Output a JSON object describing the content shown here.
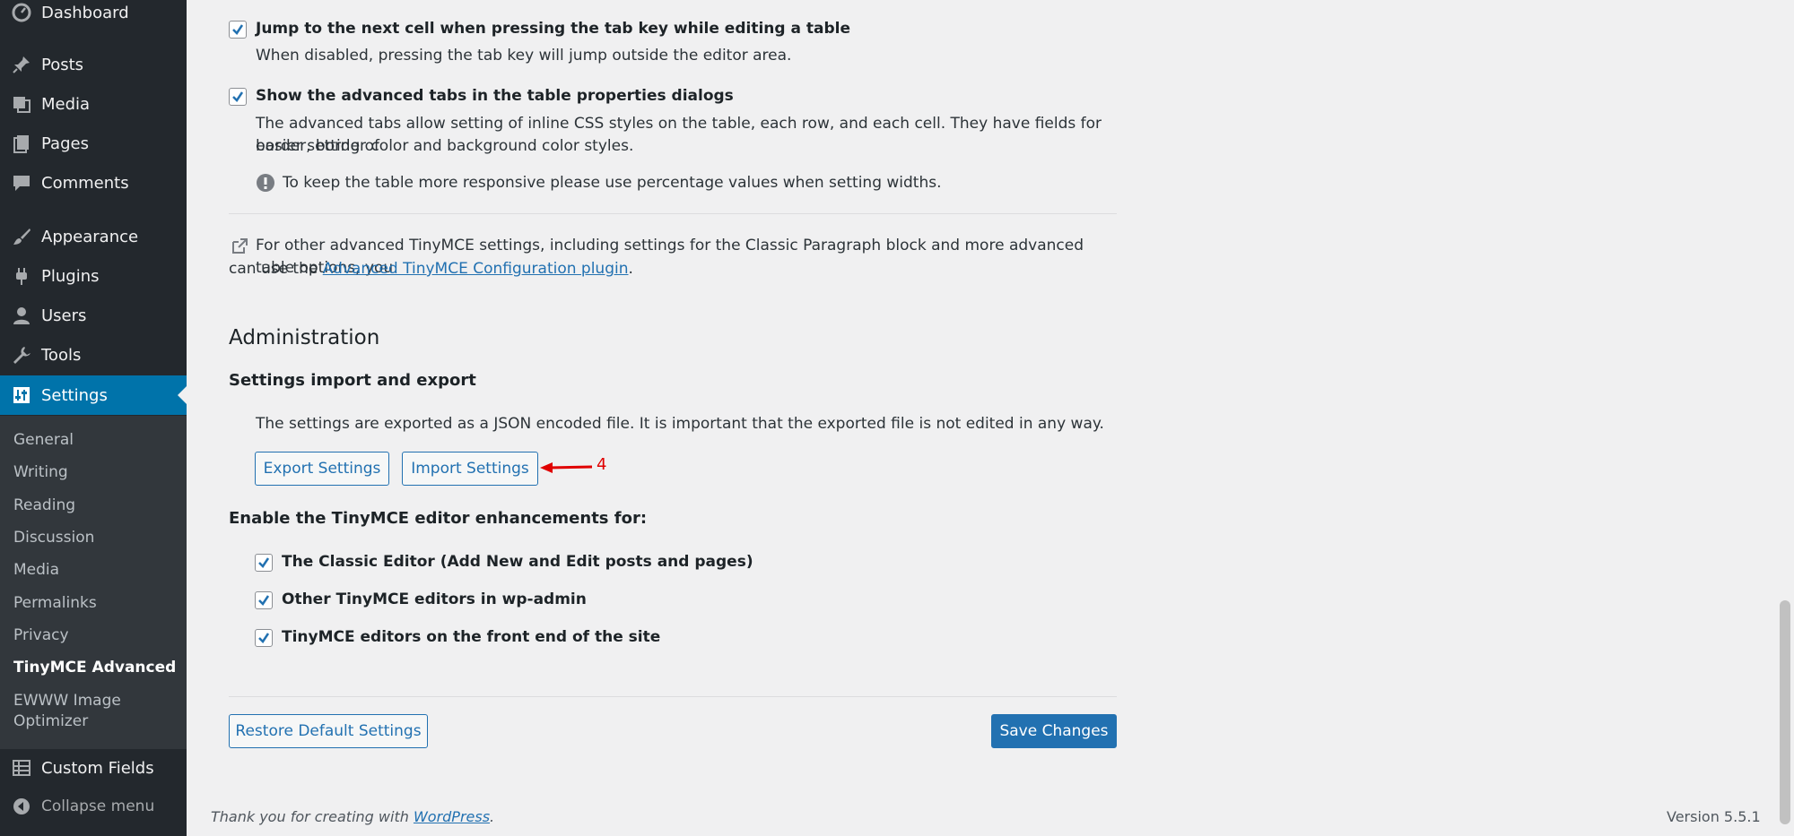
{
  "sidebar": {
    "menu": [
      {
        "label": "Dashboard",
        "icon": "dashboard-icon"
      },
      {
        "label": "Posts",
        "icon": "pin-icon"
      },
      {
        "label": "Media",
        "icon": "media-icon"
      },
      {
        "label": "Pages",
        "icon": "pages-icon"
      },
      {
        "label": "Comments",
        "icon": "comments-icon"
      },
      {
        "label": "Appearance",
        "icon": "brush-icon"
      },
      {
        "label": "Plugins",
        "icon": "plugin-icon"
      },
      {
        "label": "Users",
        "icon": "users-icon"
      },
      {
        "label": "Tools",
        "icon": "wrench-icon"
      },
      {
        "label": "Settings",
        "icon": "settings-icon"
      }
    ],
    "submenu": [
      "General",
      "Writing",
      "Reading",
      "Discussion",
      "Media",
      "Permalinks",
      "Privacy",
      "TinyMCE Advanced",
      "EWWW Image",
      "Optimizer"
    ],
    "custom_fields": "Custom Fields",
    "collapse": "Collapse menu"
  },
  "options": {
    "tab_jump": {
      "label": "Jump to the next cell when pressing the tab key while editing a table",
      "desc": "When disabled, pressing the tab key will jump outside the editor area."
    },
    "advanced_tabs": {
      "label": "Show the advanced tabs in the table properties dialogs",
      "desc_line1": "The advanced tabs allow setting of inline CSS styles on the table, each row, and each cell. They have fields for easier setting of",
      "desc_line2": "border, border color and background color styles.",
      "notice": "To keep the table more responsive please use percentage values when setting widths."
    },
    "other_settings": {
      "line1": "For other advanced TinyMCE settings, including settings for the Classic Paragraph block and more advanced table options, you",
      "line2_prefix": "can use the",
      "link": "Advanced TinyMCE Configuration plugin",
      "line2_suffix": "."
    }
  },
  "admin": {
    "heading": "Administration",
    "subheading": "Settings import and export",
    "desc": "The settings are exported as a JSON encoded file. It is important that the exported file is not edited in any way.",
    "export_btn": "Export Settings",
    "import_btn": "Import Settings",
    "annotation": "4",
    "enable_heading": "Enable the TinyMCE editor enhancements for:",
    "enable_items": [
      "The Classic Editor (Add New and Edit posts and pages)",
      "Other TinyMCE editors in wp-admin",
      "TinyMCE editors on the front end of the site"
    ]
  },
  "actions": {
    "restore": "Restore Default Settings",
    "save": "Save Changes"
  },
  "footer": {
    "thanks_prefix": "Thank you for creating with",
    "thanks_link": "WordPress",
    "thanks_suffix": ".",
    "version": "Version 5.5.1"
  },
  "colors": {
    "accent": "#2271b1",
    "active_menu": "#0073aa",
    "annotation": "#e00000"
  }
}
